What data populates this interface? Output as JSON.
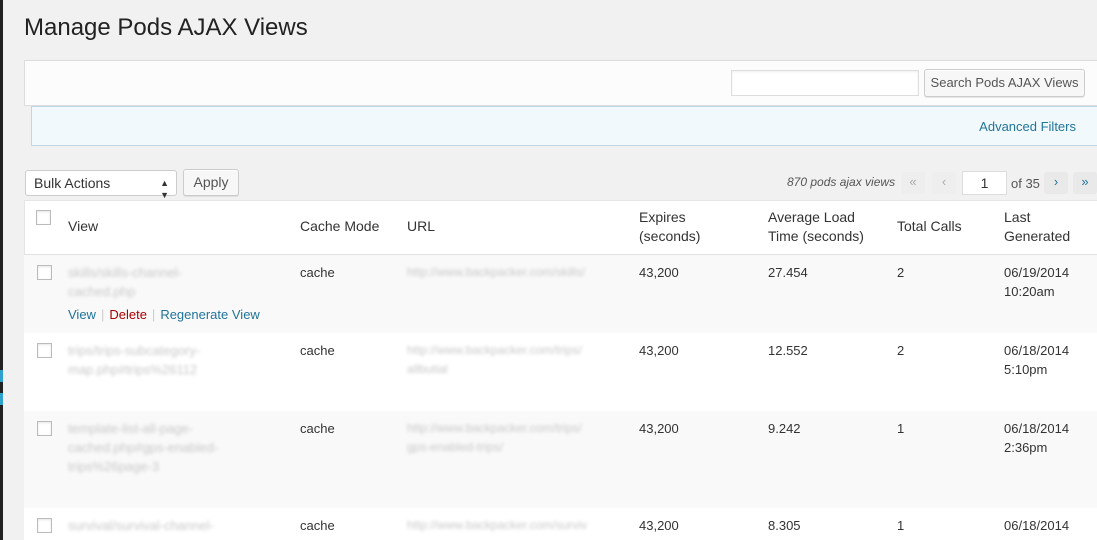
{
  "page": {
    "title": "Manage Pods AJAX Views"
  },
  "search": {
    "placeholder": "",
    "button_label": "Search Pods AJAX Views"
  },
  "filters": {
    "advanced_label": "Advanced Filters"
  },
  "bulk": {
    "selected": "Bulk Actions",
    "apply_label": "Apply"
  },
  "pagination": {
    "count_text": "870 pods ajax views",
    "first": "«",
    "prev": "‹",
    "current": "1",
    "of_text": "of 35",
    "next": "›",
    "last": "»"
  },
  "columns": {
    "view": "View",
    "cache_mode": "Cache Mode",
    "url": "URL",
    "expires_1": "Expires",
    "expires_2": "(seconds)",
    "avg_1": "Average Load",
    "avg_2": "Time (seconds)",
    "calls": "Total Calls",
    "last_1": "Last",
    "last_2": "Generated"
  },
  "row_actions": {
    "view": "View",
    "delete": "Delete",
    "regenerate": "Regenerate View"
  },
  "rows": [
    {
      "view_1": "skills/skills-channel-",
      "view_2": "cached.php",
      "view_3": "",
      "cache": "cache",
      "url_1": "http://www.backpacker.com/skills/",
      "url_2": "",
      "expires": "43,200",
      "avg": "27.454",
      "calls": "2",
      "date": "06/19/2014",
      "time": "10:20am"
    },
    {
      "view_1": "trips/trips-subcategory-",
      "view_2": "map.php#trips%26112",
      "view_3": "",
      "cache": "cache",
      "url_1": "http://www.backpacker.com/trips/",
      "url_2": "allbutial",
      "expires": "43,200",
      "avg": "12.552",
      "calls": "2",
      "date": "06/18/2014",
      "time": "5:10pm"
    },
    {
      "view_1": "template-list-all-page-",
      "view_2": "cached.php#gps-enabled-",
      "view_3": "trips%26page-3",
      "cache": "cache",
      "url_1": "http://www.backpacker.com/trips/",
      "url_2": "gps-enabled-trips/",
      "expires": "43,200",
      "avg": "9.242",
      "calls": "1",
      "date": "06/18/2014",
      "time": "2:36pm"
    },
    {
      "view_1": "survival/survival-channel-",
      "view_2": "",
      "view_3": "",
      "cache": "cache",
      "url_1": "http://www.backpacker.com/surviv",
      "url_2": "",
      "expires": "43,200",
      "avg": "8.305",
      "calls": "1",
      "date": "06/18/2014",
      "time": ""
    }
  ],
  "colors": {
    "link": "#21759b",
    "delete": "#aa0000",
    "filter_bg": "#f1f9fd"
  }
}
